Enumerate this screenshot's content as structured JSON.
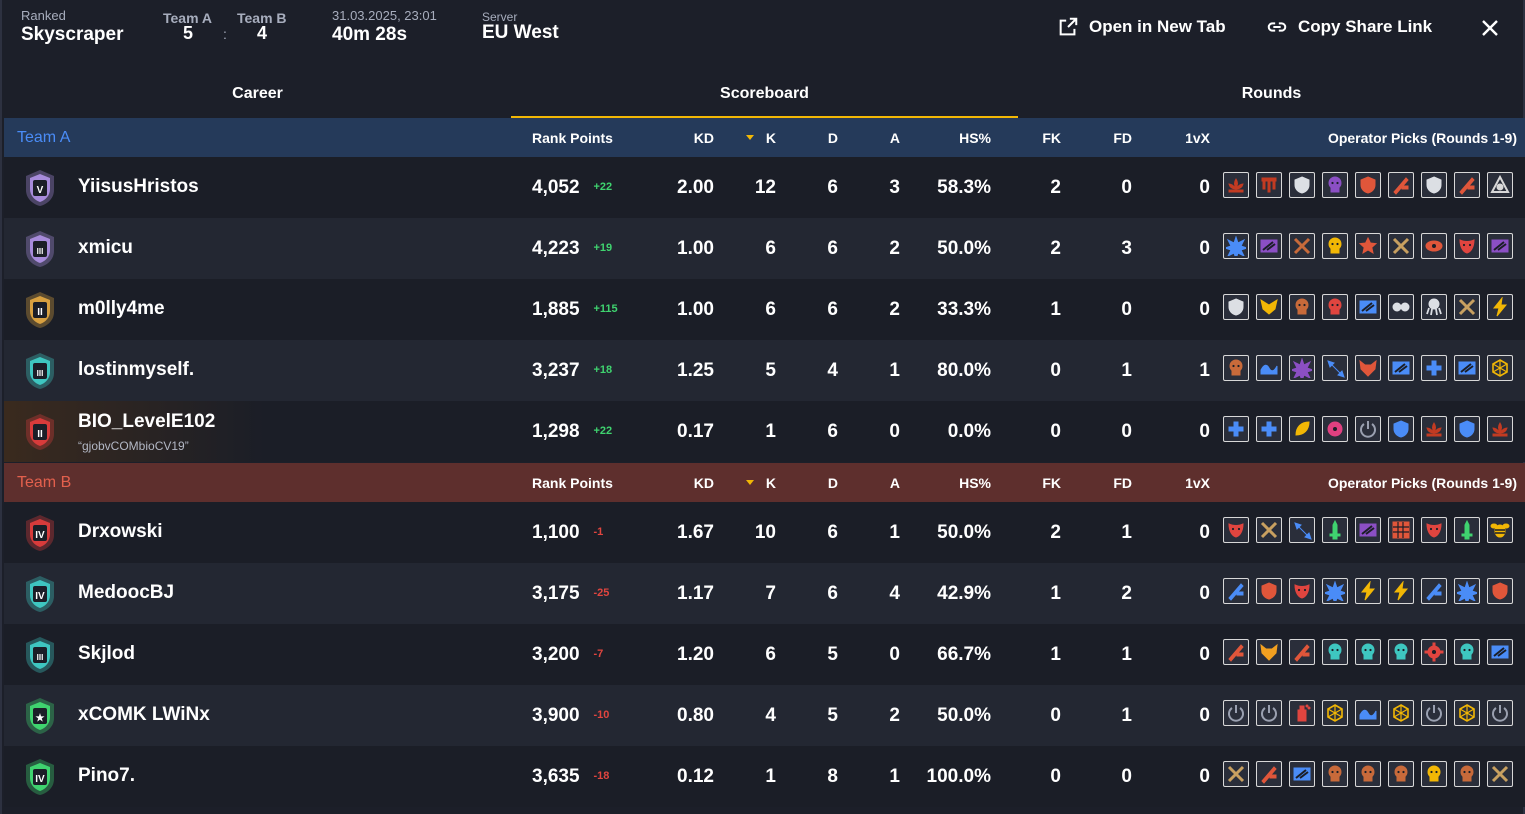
{
  "header": {
    "mode_label": "Ranked",
    "map": "Skyscraper",
    "team_a_label": "Team A",
    "team_b_label": "Team B",
    "team_a_score": "5",
    "separator": ":",
    "team_b_score": "4",
    "datetime": "31.03.2025, 23:01",
    "duration": "40m 28s",
    "server_label": "Server",
    "server": "EU West",
    "open_new_tab": "Open in New Tab",
    "copy_share_link": "Copy Share Link"
  },
  "tabs": [
    "Career",
    "Scoreboard",
    "Rounds"
  ],
  "columns": {
    "rank_points": "Rank Points",
    "kd": "KD",
    "k": "K",
    "d": "D",
    "a": "A",
    "hs": "HS%",
    "fk": "FK",
    "fd": "FD",
    "onevx": "1vX",
    "ops": "Operator Picks (Rounds 1-9)"
  },
  "colors": {
    "team_a": "#4a8cf7",
    "team_b": "#e34c3b",
    "accent": "#f2b705",
    "delta_pos": "#3fd36f",
    "delta_neg": "#e0453f"
  },
  "team_a": {
    "label": "Team A",
    "players": [
      {
        "name": "YiisusHristos",
        "rank_numeral": "V",
        "rank_color": "#a78bdb",
        "rp": "4,052",
        "delta": "+22",
        "kd": "2.00",
        "k": "12",
        "d": "6",
        "a": "3",
        "hs": "58.3%",
        "fk": "2",
        "fd": "0",
        "onevx": "0",
        "ops": [
          [
            "#c23b22",
            "lotus-icon"
          ],
          [
            "#c23b22",
            "gate-icon"
          ],
          [
            "#dcdfe4",
            "shield-icon"
          ],
          [
            "#8b4fc4",
            "skull-icon"
          ],
          [
            "#e0563a",
            "shield-icon"
          ],
          [
            "#e0563a",
            "blade-icon"
          ],
          [
            "#dcdfe4",
            "shield-icon"
          ],
          [
            "#e0563a",
            "blade-icon"
          ],
          [
            "#d8d8d8",
            "triangle-icon"
          ]
        ]
      },
      {
        "name": "xmicu",
        "rank_numeral": "III",
        "rank_color": "#a78bdb",
        "rp": "4,223",
        "delta": "+19",
        "kd": "1.00",
        "k": "6",
        "d": "6",
        "a": "2",
        "hs": "50.0%",
        "fk": "2",
        "fd": "3",
        "onevx": "0",
        "ops": [
          [
            "#4a8cf7",
            "burst-icon"
          ],
          [
            "#8b4fc4",
            "stripe-icon"
          ],
          [
            "#c86a3a",
            "cross-icon"
          ],
          [
            "#f2b705",
            "skull-icon"
          ],
          [
            "#e0563a",
            "star-icon"
          ],
          [
            "#c8a060",
            "cross-icon"
          ],
          [
            "#e0563a",
            "eye-icon"
          ],
          [
            "#e0453f",
            "mask-icon"
          ],
          [
            "#8b4fc4",
            "stripe-icon"
          ]
        ]
      },
      {
        "name": "m0lly4me",
        "rank_numeral": "II",
        "rank_color": "#d8a040",
        "rp": "1,885",
        "delta": "+115",
        "kd": "1.00",
        "k": "6",
        "d": "6",
        "a": "2",
        "hs": "33.3%",
        "fk": "1",
        "fd": "0",
        "onevx": "0",
        "ops": [
          [
            "#dcdfe4",
            "shield-icon"
          ],
          [
            "#f2b705",
            "wings-icon"
          ],
          [
            "#c86a3a",
            "skull-icon"
          ],
          [
            "#e0453f",
            "skull-icon"
          ],
          [
            "#4a8cf7",
            "stripe-icon"
          ],
          [
            "#dcdfe4",
            "goggles-icon"
          ],
          [
            "#dcdfe4",
            "octopus-icon"
          ],
          [
            "#c8a060",
            "cross-icon"
          ],
          [
            "#f2b705",
            "bolt-icon"
          ]
        ]
      },
      {
        "name": "lostinmyself.",
        "rank_numeral": "III",
        "rank_color": "#3ec6c0",
        "rp": "3,237",
        "delta": "+18",
        "kd": "1.25",
        "k": "5",
        "d": "4",
        "a": "1",
        "hs": "80.0%",
        "fk": "0",
        "fd": "1",
        "onevx": "1",
        "ops": [
          [
            "#c86a3a",
            "skull-icon"
          ],
          [
            "#4a8cf7",
            "wave-icon"
          ],
          [
            "#8b4fc4",
            "burst-icon"
          ],
          [
            "#4a8cf7",
            "arrows-icon"
          ],
          [
            "#e0563a",
            "fox-icon"
          ],
          [
            "#4a8cf7",
            "stripe-icon"
          ],
          [
            "#4a8cf7",
            "plus-icon"
          ],
          [
            "#4a8cf7",
            "stripe-icon"
          ],
          [
            "#f2b705",
            "web-icon"
          ]
        ]
      },
      {
        "name": "BIO_LevelE102",
        "subtitle": "“gjobvCOMbioCV19”",
        "rank_numeral": "II",
        "rank_color": "#d83b3b",
        "rp": "1,298",
        "delta": "+22",
        "kd": "0.17",
        "k": "1",
        "d": "6",
        "a": "0",
        "hs": "0.0%",
        "fk": "0",
        "fd": "0",
        "onevx": "0",
        "ops": [
          [
            "#4a8cf7",
            "plus-icon"
          ],
          [
            "#4a8cf7",
            "plus-icon"
          ],
          [
            "#f2b705",
            "leaf-icon"
          ],
          [
            "#e04080",
            "radiation-icon"
          ],
          [
            "#9aa0b0",
            "power-icon"
          ],
          [
            "#4a8cf7",
            "shield-icon"
          ],
          [
            "#c23b22",
            "lotus-icon"
          ],
          [
            "#4a8cf7",
            "shield-icon"
          ],
          [
            "#c23b22",
            "lotus-icon"
          ]
        ]
      }
    ]
  },
  "team_b": {
    "label": "Team B",
    "players": [
      {
        "name": "Drxowski",
        "rank_numeral": "IV",
        "rank_color": "#d83b3b",
        "rp": "1,100",
        "delta": "-1",
        "kd": "1.67",
        "k": "10",
        "d": "6",
        "a": "1",
        "hs": "50.0%",
        "fk": "2",
        "fd": "1",
        "onevx": "0",
        "ops": [
          [
            "#e0453f",
            "mask-icon"
          ],
          [
            "#c8a060",
            "cross-icon"
          ],
          [
            "#4a8cf7",
            "arrows-icon"
          ],
          [
            "#3fd36f",
            "sword-icon"
          ],
          [
            "#8b4fc4",
            "stripe-icon"
          ],
          [
            "#e0563a",
            "grid-icon"
          ],
          [
            "#e0453f",
            "mask-icon"
          ],
          [
            "#3fd36f",
            "sword-icon"
          ],
          [
            "#f2b705",
            "bee-icon"
          ]
        ]
      },
      {
        "name": "MedoocBJ",
        "rank_numeral": "IV",
        "rank_color": "#3ec6c0",
        "rp": "3,175",
        "delta": "-25",
        "kd": "1.17",
        "k": "7",
        "d": "6",
        "a": "4",
        "hs": "42.9%",
        "fk": "1",
        "fd": "2",
        "onevx": "0",
        "ops": [
          [
            "#4a8cf7",
            "blade-icon"
          ],
          [
            "#e0563a",
            "shield-icon"
          ],
          [
            "#e0453f",
            "mask-icon"
          ],
          [
            "#4a8cf7",
            "burst-icon"
          ],
          [
            "#f2b705",
            "bolt-icon"
          ],
          [
            "#f2b705",
            "bolt-icon"
          ],
          [
            "#4a8cf7",
            "blade-icon"
          ],
          [
            "#4a8cf7",
            "burst-icon"
          ],
          [
            "#e0563a",
            "shield-icon"
          ]
        ]
      },
      {
        "name": "Skjlod",
        "rank_numeral": "III",
        "rank_color": "#3ec6c0",
        "rp": "3,200",
        "delta": "-7",
        "kd": "1.20",
        "k": "6",
        "d": "5",
        "a": "0",
        "hs": "66.7%",
        "fk": "1",
        "fd": "1",
        "onevx": "0",
        "ops": [
          [
            "#e0563a",
            "blade-icon"
          ],
          [
            "#f2a020",
            "fox-icon"
          ],
          [
            "#e0563a",
            "blade-icon"
          ],
          [
            "#3ec6c0",
            "skull-icon"
          ],
          [
            "#3ec6c0",
            "skull-icon"
          ],
          [
            "#3ec6c0",
            "skull-icon"
          ],
          [
            "#e0453f",
            "cog-icon"
          ],
          [
            "#3ec6c0",
            "skull-icon"
          ],
          [
            "#4a8cf7",
            "stripe-icon"
          ]
        ]
      },
      {
        "name": "xCOMK LWiNx",
        "rank_numeral": "★",
        "rank_color": "#3fd36f",
        "rp": "3,900",
        "delta": "-10",
        "kd": "0.80",
        "k": "4",
        "d": "5",
        "a": "2",
        "hs": "50.0%",
        "fk": "0",
        "fd": "1",
        "onevx": "0",
        "ops": [
          [
            "#9aa0b0",
            "power-icon"
          ],
          [
            "#9aa0b0",
            "power-icon"
          ],
          [
            "#e0453f",
            "spray-icon"
          ],
          [
            "#f2b705",
            "web-icon"
          ],
          [
            "#4a8cf7",
            "wave-icon"
          ],
          [
            "#f2b705",
            "web-icon"
          ],
          [
            "#9aa0b0",
            "power-icon"
          ],
          [
            "#f2b705",
            "web-icon"
          ],
          [
            "#9aa0b0",
            "power-icon"
          ]
        ]
      },
      {
        "name": "Pino7.",
        "rank_numeral": "IV",
        "rank_color": "#3fd36f",
        "rp": "3,635",
        "delta": "-18",
        "kd": "0.12",
        "k": "1",
        "d": "8",
        "a": "1",
        "hs": "100.0%",
        "fk": "0",
        "fd": "0",
        "onevx": "0",
        "ops": [
          [
            "#c8a060",
            "cross-icon"
          ],
          [
            "#e0563a",
            "blade-icon"
          ],
          [
            "#4a8cf7",
            "stripe-icon"
          ],
          [
            "#c86a3a",
            "skull-icon"
          ],
          [
            "#c86a3a",
            "skull-icon"
          ],
          [
            "#c86a3a",
            "skull-icon"
          ],
          [
            "#f2b705",
            "skull-icon"
          ],
          [
            "#c86a3a",
            "skull-icon"
          ],
          [
            "#c8a060",
            "cross-icon"
          ]
        ]
      }
    ]
  }
}
